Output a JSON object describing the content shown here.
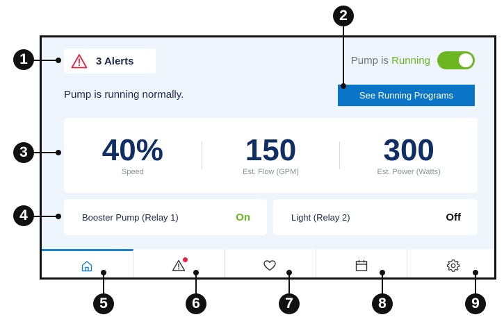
{
  "alerts": {
    "label": "3 Alerts",
    "icon": "warning-triangle-icon",
    "color": "#e8203f"
  },
  "status_message": "Pump is running normally.",
  "pump_status": {
    "prefix": "Pump is",
    "state": "Running",
    "toggle_on": true
  },
  "programs_button": {
    "label": "See Running Programs"
  },
  "stats": [
    {
      "value": "40%",
      "caption": "Speed"
    },
    {
      "value": "150",
      "caption": "Est. Flow (GPM)"
    },
    {
      "value": "300",
      "caption": "Est. Power (Watts)"
    }
  ],
  "relays": [
    {
      "name": "Booster Pump (Relay 1)",
      "state": "On"
    },
    {
      "name": "Light (Relay 2)",
      "state": "Off"
    }
  ],
  "nav": [
    {
      "icon": "home-icon",
      "active": true
    },
    {
      "icon": "alert-icon",
      "has_badge": true
    },
    {
      "icon": "heart-icon"
    },
    {
      "icon": "calendar-icon"
    },
    {
      "icon": "gear-icon"
    }
  ],
  "callouts": [
    "1",
    "2",
    "3",
    "4",
    "5",
    "6",
    "7",
    "8",
    "9"
  ],
  "colors": {
    "accent": "#0a74c7",
    "running_green": "#6cb622",
    "alert_red": "#e8203f",
    "value_navy": "#0f2e64"
  }
}
